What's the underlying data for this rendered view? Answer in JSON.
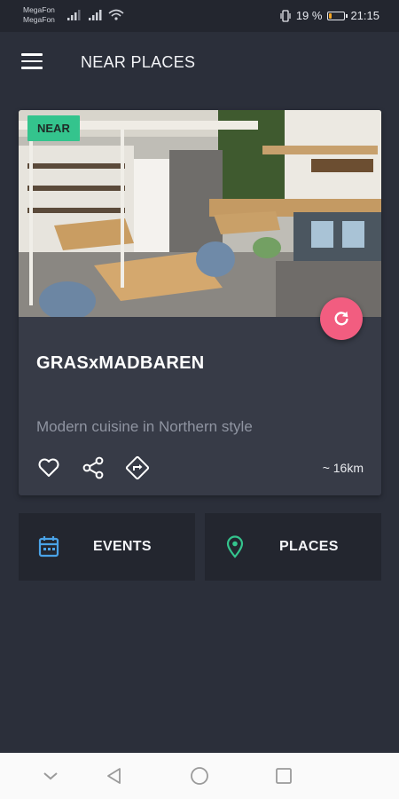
{
  "status_bar": {
    "carrier_1": "MegaFon",
    "carrier_2": "MegaFon",
    "battery_percent": "19 %",
    "battery_level": 0.19,
    "time": "21:15"
  },
  "app_bar": {
    "title": "NEAR PLACES",
    "menu_icon": "hamburger-icon"
  },
  "place_card": {
    "badge": "NEAR",
    "name": "GRASxMADBAREN",
    "description": "Modern cuisine in Northern style",
    "distance": "~ 16km",
    "actions": [
      "heart-icon",
      "share-icon",
      "directions-icon"
    ],
    "refresh_icon": "refresh-icon"
  },
  "nav_buttons": {
    "events": {
      "label": "EVENTS",
      "icon": "calendar-icon"
    },
    "places": {
      "label": "PLACES",
      "icon": "location-pin-icon"
    }
  },
  "colors": {
    "background": "#2b2f3a",
    "card": "#373b47",
    "badge": "#34c48d",
    "fab": "#f25d80",
    "events_icon": "#4aa3e8",
    "places_icon": "#34c48d"
  },
  "system_nav": [
    "back-icon",
    "home-icon",
    "recents-icon",
    "chevron-down-icon"
  ]
}
